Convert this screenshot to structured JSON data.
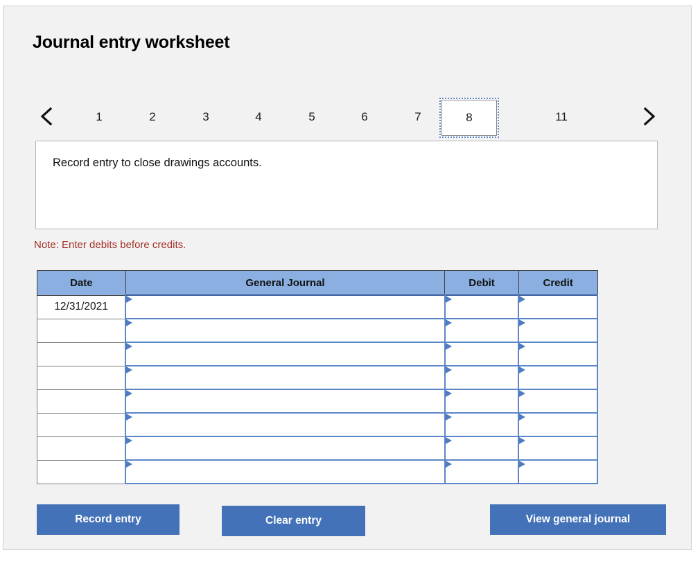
{
  "worksheet": {
    "title": "Journal entry worksheet",
    "note": "Note: Enter debits before credits.",
    "description": "Record entry to close drawings accounts."
  },
  "pager": {
    "prev_icon": "chevron-left-icon",
    "next_icon": "chevron-right-icon",
    "selected": "8",
    "tabs": [
      {
        "label": "1",
        "selected": false
      },
      {
        "label": "2",
        "selected": false
      },
      {
        "label": "3",
        "selected": false
      },
      {
        "label": "4",
        "selected": false
      },
      {
        "label": "5",
        "selected": false
      },
      {
        "label": "6",
        "selected": false
      },
      {
        "label": "7",
        "selected": false
      },
      {
        "label": "8",
        "selected": true
      },
      {
        "label": "11",
        "selected": false
      }
    ]
  },
  "table": {
    "headers": {
      "date": "Date",
      "general_journal": "General Journal",
      "debit": "Debit",
      "credit": "Credit"
    },
    "rows": [
      {
        "date": "12/31/2021",
        "general_journal": "",
        "debit": "",
        "credit": ""
      },
      {
        "date": "",
        "general_journal": "",
        "debit": "",
        "credit": ""
      },
      {
        "date": "",
        "general_journal": "",
        "debit": "",
        "credit": ""
      },
      {
        "date": "",
        "general_journal": "",
        "debit": "",
        "credit": ""
      },
      {
        "date": "",
        "general_journal": "",
        "debit": "",
        "credit": ""
      },
      {
        "date": "",
        "general_journal": "",
        "debit": "",
        "credit": ""
      },
      {
        "date": "",
        "general_journal": "",
        "debit": "",
        "credit": ""
      },
      {
        "date": "",
        "general_journal": "",
        "debit": "",
        "credit": ""
      }
    ]
  },
  "buttons": {
    "record_entry": "Record entry",
    "clear_entry": "Clear entry",
    "view_general_journal": "View general journal"
  },
  "colors": {
    "header_blue": "#8aafe0",
    "button_blue": "#4472b8",
    "cell_border_blue": "#5b86c8",
    "note_red": "#a43028",
    "card_background": "#f2f2f2"
  }
}
